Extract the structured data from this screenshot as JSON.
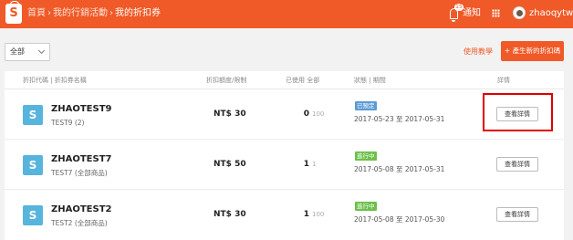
{
  "header": {
    "logo_letter": "S",
    "breadcrumbs": [
      "首頁",
      "我的行銷活動",
      "我的折扣券"
    ],
    "notification_count": "15",
    "notification_label": "通知",
    "username": "zhaoqytw"
  },
  "toolbar": {
    "filter_value": "全部",
    "help_link": "使用教學",
    "new_button": "+ 產生新的折扣碼"
  },
  "table": {
    "headers": {
      "code_name": "折扣代碼 | 折扣券名稱",
      "discount": "折扣額度/限制",
      "usage": "已使用  全部",
      "status": "狀態 | 期間",
      "detail": "詳情"
    },
    "rows": [
      {
        "icon": "S",
        "code": "ZHAOTEST9",
        "name": "TEST9 (2)",
        "amount": "NT$ 30",
        "used": "0",
        "total": "100",
        "status": "已預定",
        "status_color": "#5b9bd5",
        "period": "2017-05-23 至 2017-05-31",
        "detail_label": "查看詳情"
      },
      {
        "icon": "S",
        "code": "ZHAOTEST7",
        "name": "TEST7 (全部商品)",
        "amount": "NT$ 50",
        "used": "1",
        "total": "1",
        "status": "進行中",
        "status_color": "#6cc04a",
        "period": "2017-05-08 至 2017-05-31",
        "detail_label": "查看詳情"
      },
      {
        "icon": "S",
        "code": "ZHAOTEST2",
        "name": "TEST2 (全部商品)",
        "amount": "NT$ 30",
        "used": "1",
        "total": "100",
        "status": "進行中",
        "status_color": "#6cc04a",
        "period": "2017-05-08 至 2017-05-30",
        "detail_label": "查看詳情"
      }
    ]
  },
  "colors": {
    "brand": "#f05a28",
    "highlight": "#e00000",
    "voucher_icon": "#57b4dd"
  }
}
